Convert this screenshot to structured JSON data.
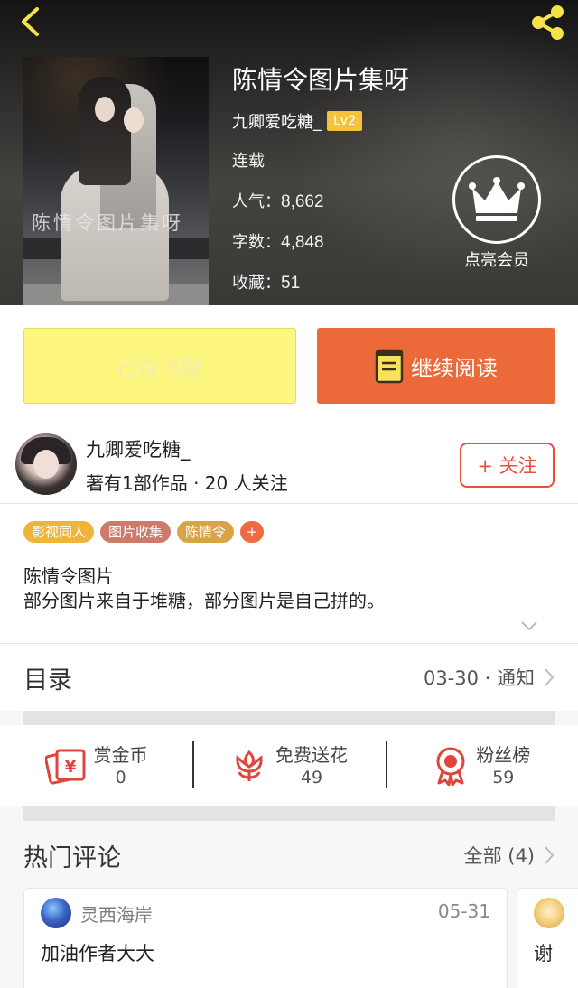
{
  "header": {
    "cover_text": "陈情令图片集呀",
    "title": "陈情令图片集呀",
    "author": "九卿爱吃糖_",
    "level": "Lv2",
    "status": "连载",
    "popularity_label": "人气：",
    "popularity": "8,662",
    "words_label": "字数：",
    "words": "4,848",
    "favorites_label": "收藏：",
    "favorites": "51",
    "vip_label": "点亮会员"
  },
  "actions": {
    "shelf_label": "已在书架",
    "read_label": "继续阅读"
  },
  "author_card": {
    "name": "九卿爱吃糖_",
    "stats": "著有1部作品 · 20 人关注",
    "follow_label": "+ 关注"
  },
  "tags": [
    {
      "label": "影视同人",
      "color": "#f0b43a"
    },
    {
      "label": "图片收集",
      "color": "#cd7a6b"
    },
    {
      "label": "陈情令",
      "color": "#d9a447"
    }
  ],
  "tag_add": "+",
  "description": "陈情令图片\n部分图片来自于堆糖，部分图片是自己拼的。",
  "catalog": {
    "title": "目录",
    "latest": "03-30 · 通知"
  },
  "stats": [
    {
      "label": "赏金币",
      "value": "0",
      "icon": "gold-coin-icon"
    },
    {
      "label": "免费送花",
      "value": "49",
      "icon": "flower-icon"
    },
    {
      "label": "粉丝榜",
      "value": "59",
      "icon": "medal-icon"
    }
  ],
  "comments": {
    "title": "热门评论",
    "all_label": "全部 (4)",
    "items": [
      {
        "user": "灵西海岸",
        "date": "05-31",
        "text": "加油作者大大"
      },
      {
        "user": "",
        "date": "",
        "text": "谢"
      }
    ]
  },
  "colors": {
    "accent": "#ec6a3a",
    "shelf_bg": "#fdf780",
    "follow": "#e94f3b",
    "level_badge": "#f5c33a",
    "icon_red": "#e0443a"
  }
}
